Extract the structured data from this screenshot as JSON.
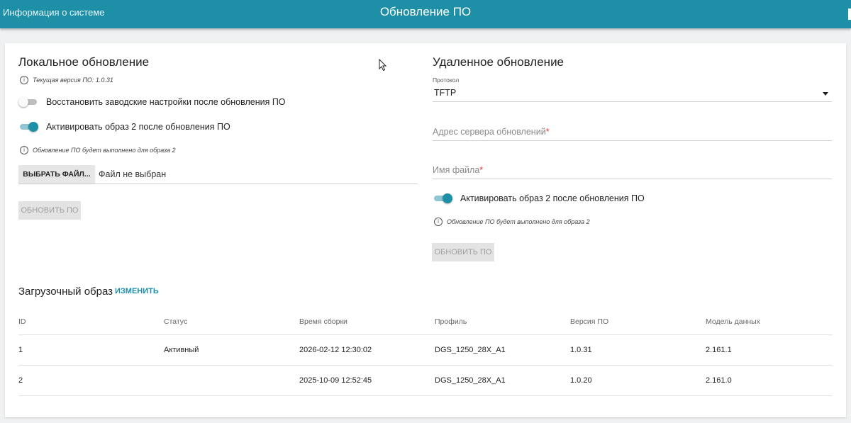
{
  "header": {
    "back_link": "Информация о системе",
    "title": "Обновление ПО"
  },
  "local_update": {
    "title": "Локальное обновление",
    "current_version": "Текущая версия ПО: 1.0.31",
    "restore_defaults": {
      "label": "Восстановить заводские настройки после обновления ПО",
      "checked": false
    },
    "activate_image2": {
      "label": "Активировать образ 2 после обновления ПО",
      "checked": true
    },
    "note": "Обновление ПО будет выполнено для образа 2",
    "choose_file_label": "ВЫБРАТЬ ФАЙЛ...",
    "file_status": "Файл не выбран",
    "update_button": "ОБНОВИТЬ ПО"
  },
  "remote_update": {
    "title": "Удаленное обновление",
    "protocol_label": "Протокол",
    "protocol_value": "TFTP",
    "server_placeholder": "Адрес сервера обновлений",
    "filename_placeholder": "Имя файла",
    "required_mark": "*",
    "activate_image2": {
      "label": "Активировать образ 2 после обновления ПО",
      "checked": true
    },
    "note": "Обновление ПО будет выполнено для образа 2",
    "update_button": "ОБНОВИТЬ ПО"
  },
  "boot_image": {
    "title": "Загрузочный образ",
    "change_link": "ИЗМЕНИТЬ",
    "columns": [
      "ID",
      "Статус",
      "Время сборки",
      "Профиль",
      "Версия ПО",
      "Модель данных"
    ],
    "rows": [
      [
        "1",
        "Активный",
        "2026-02-12 12:30:02",
        "DGS_1250_28X_A1",
        "1.0.31",
        "2.161.1"
      ],
      [
        "2",
        "",
        "2025-10-09 12:52:45",
        "DGS_1250_28X_A1",
        "1.0.20",
        "2.161.0"
      ]
    ]
  },
  "icons": {
    "info": "info-icon",
    "dropdown": "chevron-down-icon"
  },
  "colors": {
    "accent": "#1d8fa6",
    "toggle_track_on": "#8fc6d3",
    "required": "#e53935"
  }
}
